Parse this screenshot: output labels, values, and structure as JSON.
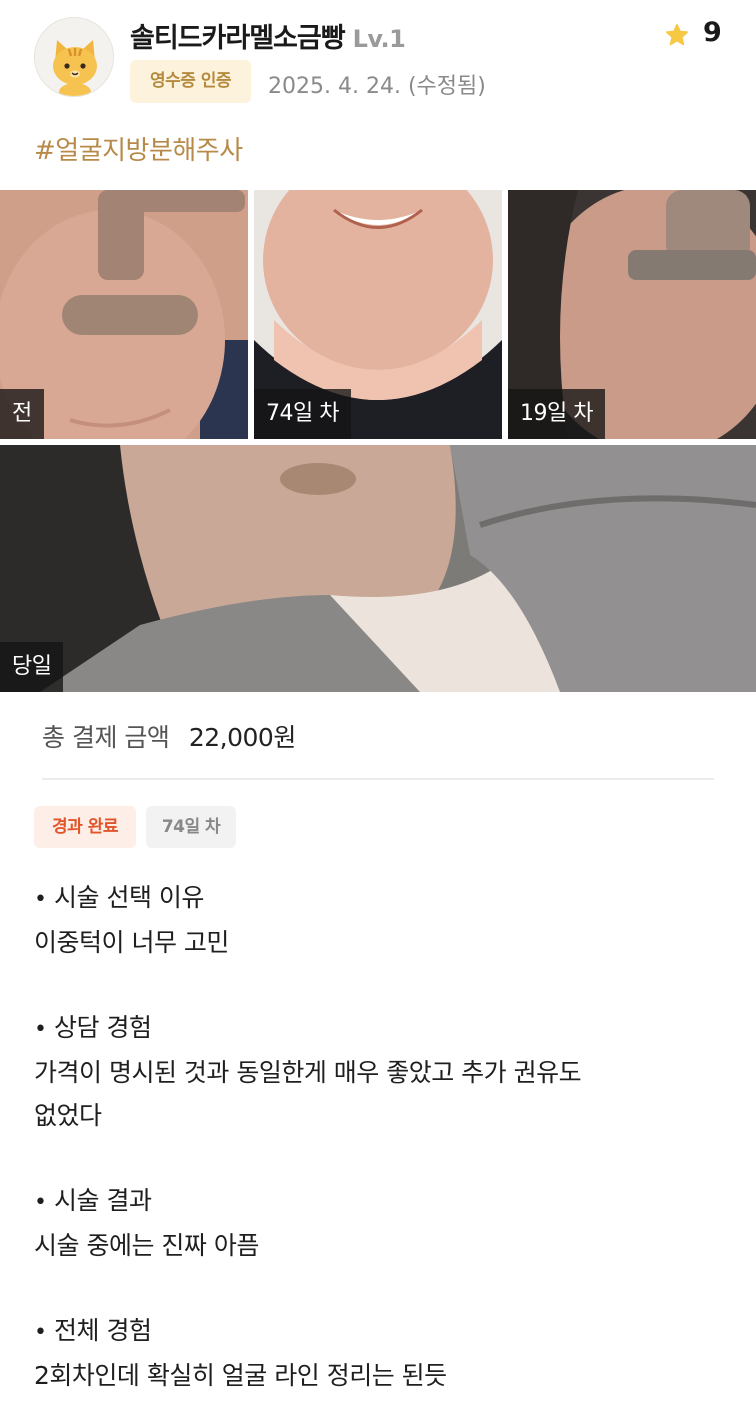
{
  "header": {
    "username": "솔티드카라멜소금빵",
    "level": "Lv.1",
    "receipt_badge": "영수증 인증",
    "date": "2025. 4. 24. (수정됨)",
    "rating": "9",
    "avatar_icon": "cat-avatar-icon",
    "star_icon": "star-icon",
    "star_color": "#f7c843"
  },
  "hashtag": "#얼굴지방분해주사",
  "photos": [
    {
      "label": "전"
    },
    {
      "label": "74일 차"
    },
    {
      "label": "19일 차"
    },
    {
      "label": "당일"
    }
  ],
  "payment": {
    "label": "총 결제 금액",
    "amount": "22,000원"
  },
  "badges": {
    "status": "경과 완료",
    "day": "74일 차",
    "status_color": "#e0552a"
  },
  "review": [
    {
      "title": "시술 선택 이유",
      "lines": [
        "이중턱이 너무 고민"
      ]
    },
    {
      "title": "상담 경험",
      "lines": [
        "가격이 명시된 것과 동일한게 매우 좋았고 추가 권유도",
        "없었다"
      ]
    },
    {
      "title": "시술 결과",
      "lines": [
        "시술 중에는 진짜 아픔"
      ]
    },
    {
      "title": "전체 경험",
      "lines": [
        "2회차인데 확실히 얼굴 라인 정리는 된듯"
      ]
    }
  ]
}
